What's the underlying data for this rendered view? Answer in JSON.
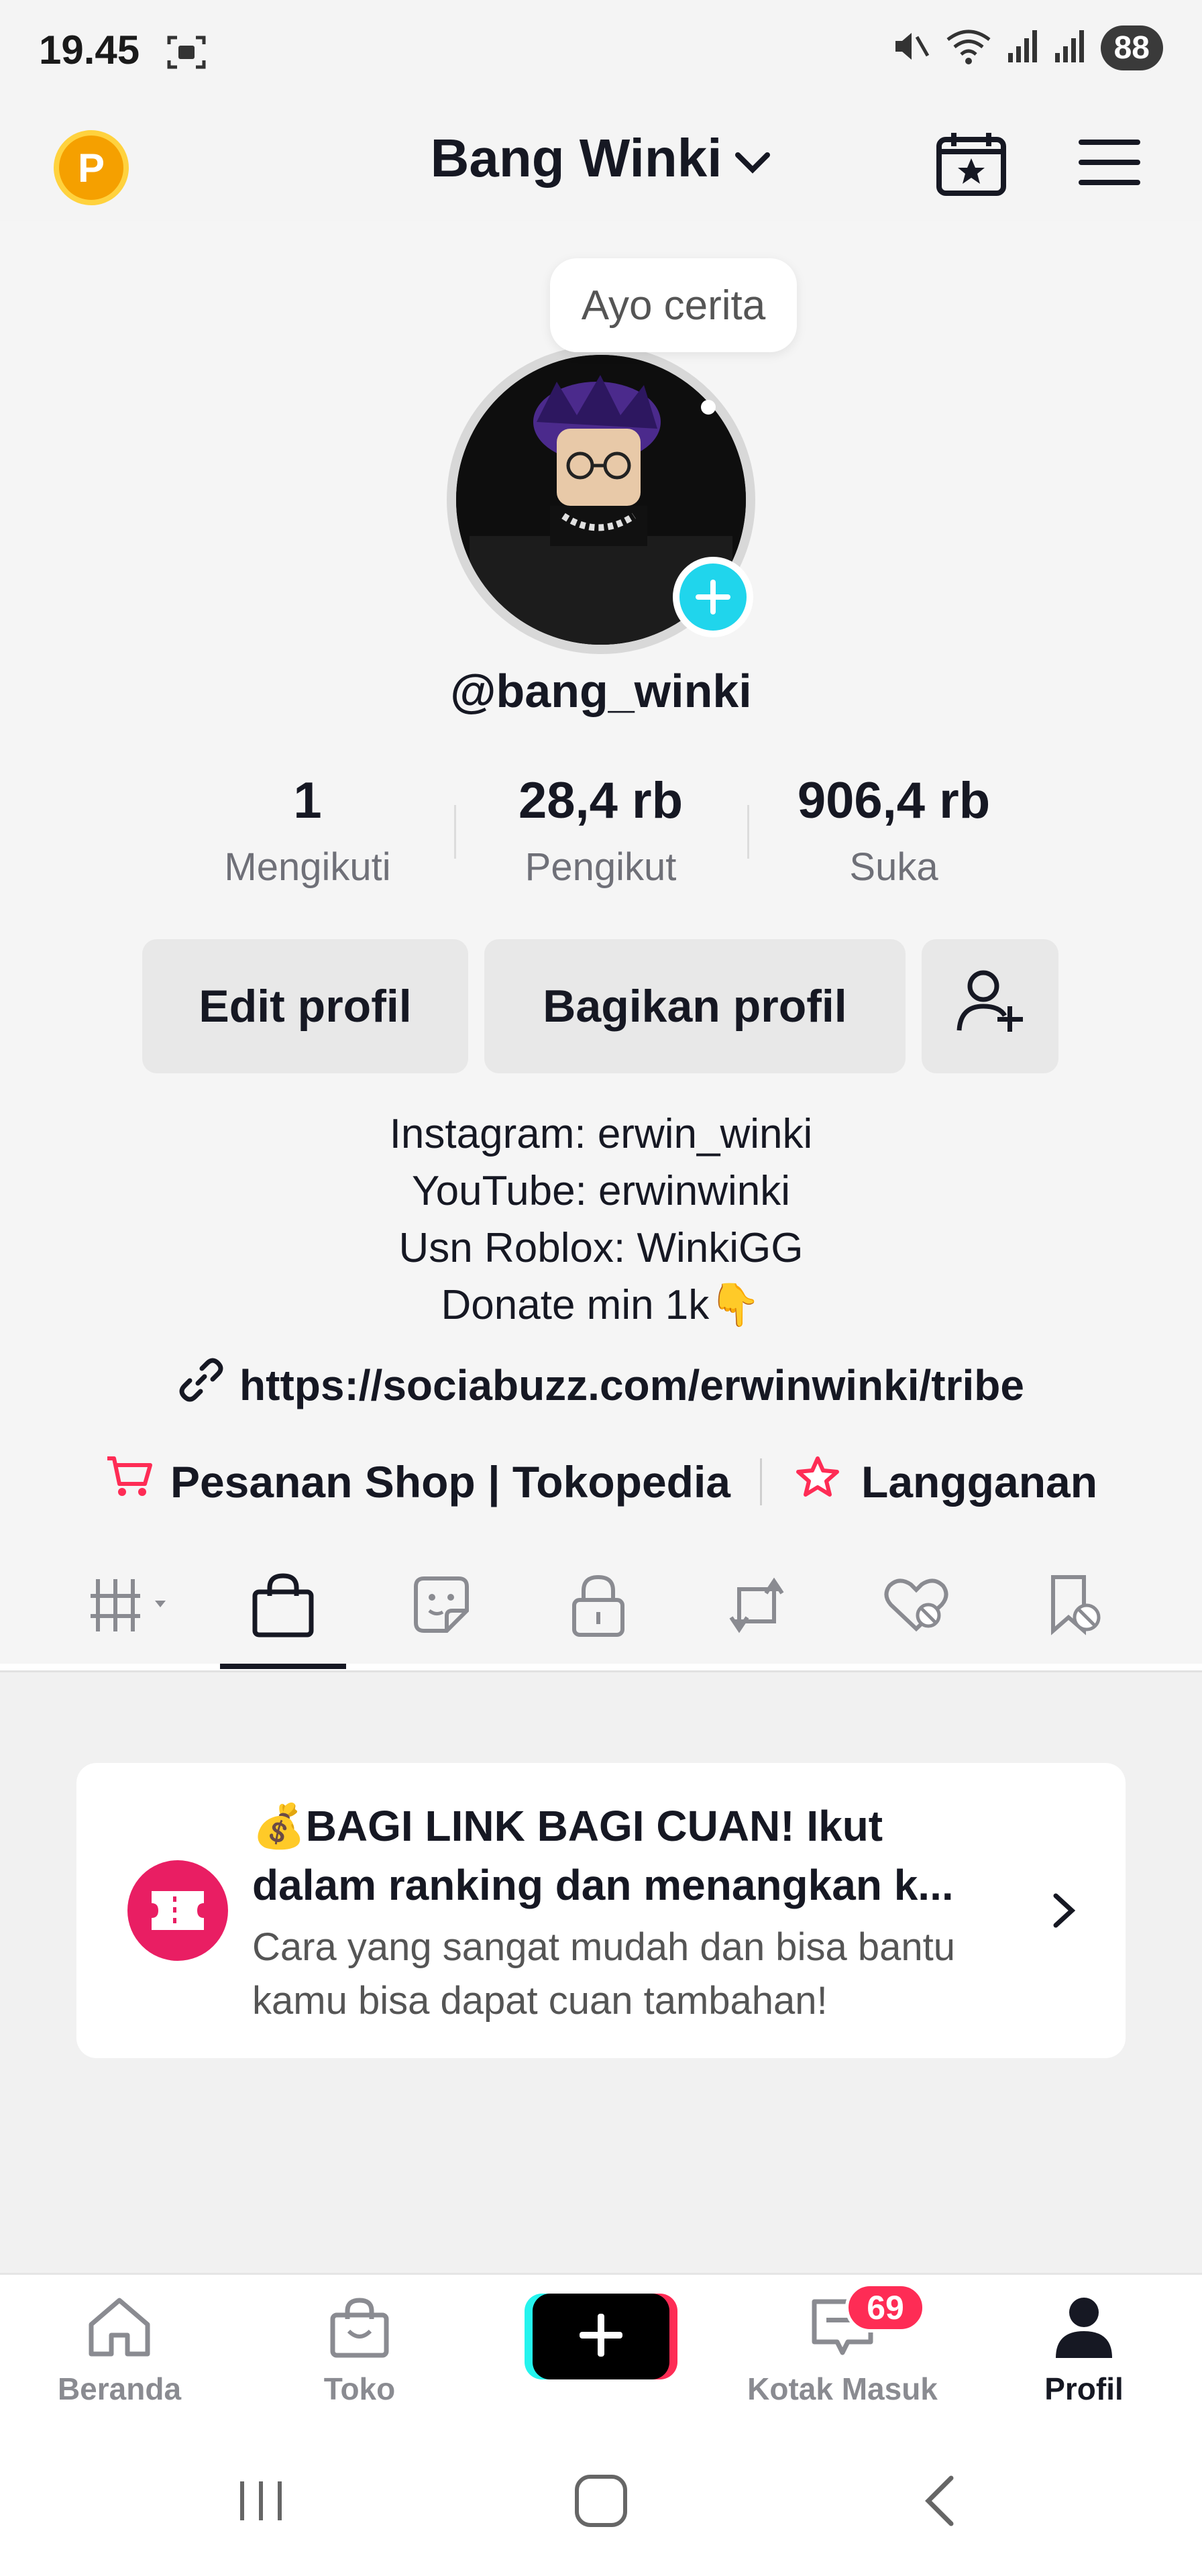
{
  "status_bar": {
    "time": "19.45",
    "battery": "88",
    "icons": [
      "screenshot-icon",
      "mute-icon",
      "wifi-icon",
      "signal-icon",
      "signal-icon"
    ]
  },
  "header": {
    "coin_label": "P",
    "title": "Bang Winki",
    "icons": [
      "calendar-star-icon",
      "menu-icon"
    ]
  },
  "profile": {
    "bubble": "Ayo cerita",
    "handle": "@bang_winki",
    "stats": [
      {
        "value": "1",
        "label": "Mengikuti"
      },
      {
        "value": "28,4 rb",
        "label": "Pengikut"
      },
      {
        "value": "906,4 rb",
        "label": "Suka"
      }
    ],
    "buttons": {
      "edit": "Edit profil",
      "share": "Bagikan profil"
    },
    "bio": [
      "Instagram: erwin_winki",
      "YouTube: erwinwinki",
      "Usn Roblox: WinkiGG",
      "Donate min 1k👇"
    ],
    "link": "https://sociabuzz.com/erwinwinki/tribe",
    "shop": "Pesanan Shop | Tokopedia",
    "subscription": "Langganan"
  },
  "tabs": {
    "icons": [
      "grid-icon",
      "shopping-bag-icon",
      "sticker-icon",
      "lock-icon",
      "repost-icon",
      "liked-hidden-icon",
      "favorites-hidden-icon"
    ],
    "active": 1
  },
  "promo": {
    "title": "💰BAGI LINK BAGI CUAN! Ikut dalam ranking dan menangkan k...",
    "subtitle": "Cara yang sangat mudah dan bisa bantu kamu bisa dapat cuan tambahan!"
  },
  "bottom_nav": {
    "items": [
      {
        "label": "Beranda",
        "icon": "home-icon"
      },
      {
        "label": "Toko",
        "icon": "shop-icon"
      },
      {
        "label": "",
        "icon": "plus-icon"
      },
      {
        "label": "Kotak Masuk",
        "icon": "inbox-icon"
      },
      {
        "label": "Profil",
        "icon": "profile-icon"
      }
    ],
    "inbox_badge": "69"
  },
  "colors": {
    "accent_red": "#fe2c55",
    "accent_cyan": "#25f4ee",
    "promo_icon": "#e91e63",
    "coin": "#f5a000"
  }
}
